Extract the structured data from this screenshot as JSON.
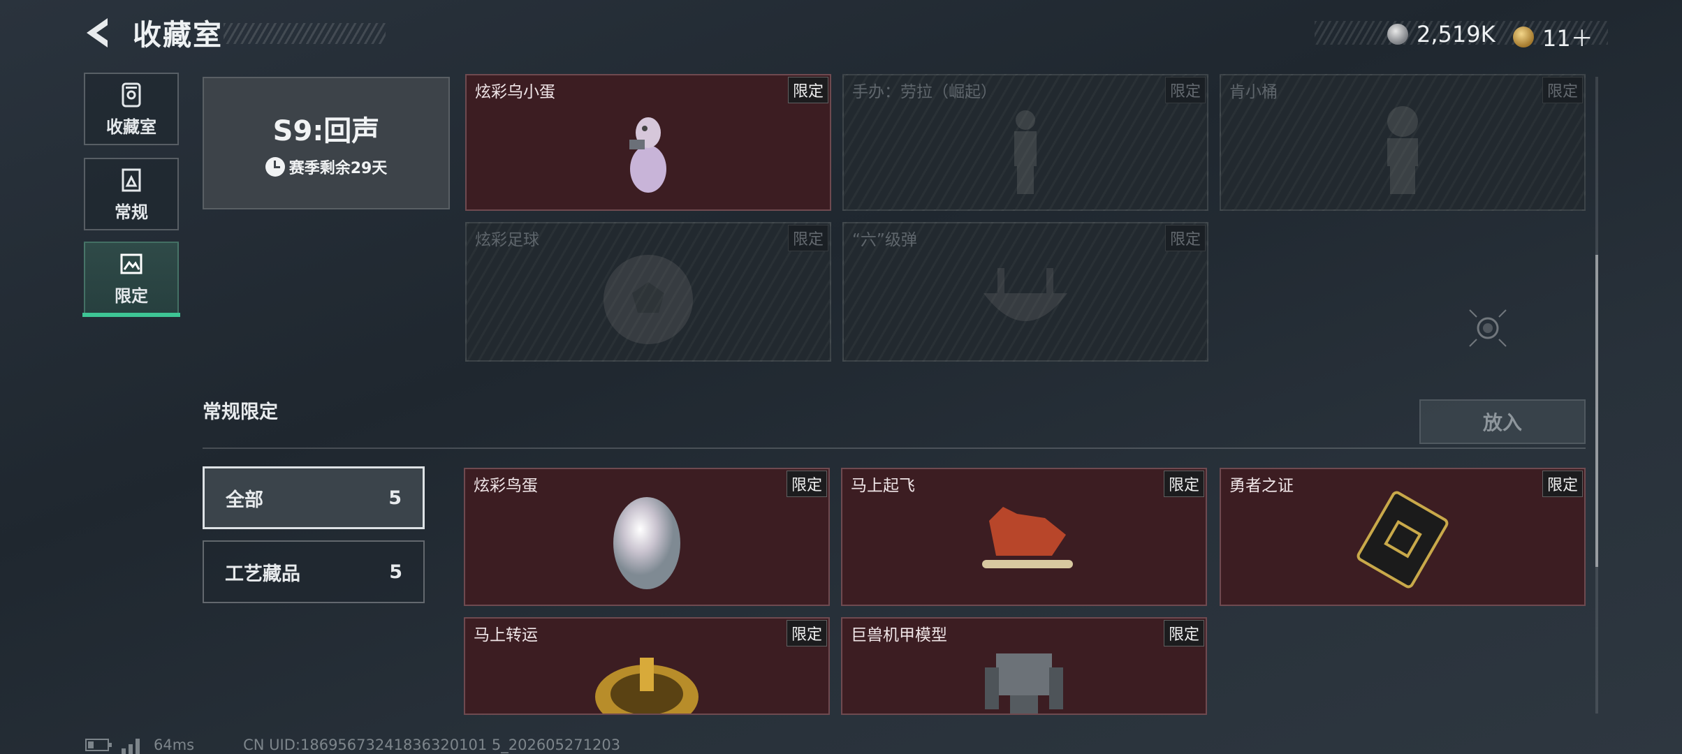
{
  "header": {
    "title": "收藏室",
    "currency1": "2,519K",
    "currency2": "11＋",
    "currency1_icon": "silver-coin-icon",
    "currency2_icon": "gold-triangle-coin-icon"
  },
  "nav": [
    {
      "label": "收藏室",
      "icon": "trophy-icon"
    },
    {
      "label": "常规",
      "icon": "document-icon"
    },
    {
      "label": "限定",
      "icon": "image-icon",
      "active": true
    }
  ],
  "season": {
    "name": "S9:回声",
    "remaining": "赛季剩余29天"
  },
  "season_cards": [
    {
      "name": "炫彩乌小蛋",
      "tag": "限定",
      "owned": true
    },
    {
      "name": "手办：劳拉（崛起）",
      "tag": "限定",
      "owned": false
    },
    {
      "name": "肯小桶",
      "tag": "限定",
      "owned": false
    },
    {
      "name": "炫彩足球",
      "tag": "限定",
      "owned": false
    },
    {
      "name": "“六”级弹",
      "tag": "限定",
      "owned": false
    }
  ],
  "section": {
    "title": "常规限定",
    "put_button": "放入"
  },
  "filters": [
    {
      "label": "全部",
      "count": "5",
      "active": true
    },
    {
      "label": "工艺藏品",
      "count": "5"
    }
  ],
  "regular_cards": [
    {
      "name": "炫彩鸟蛋",
      "tag": "限定"
    },
    {
      "name": "马上起飞",
      "tag": "限定"
    },
    {
      "name": "勇者之证",
      "tag": "限定"
    },
    {
      "name": "马上转运",
      "tag": "限定"
    },
    {
      "name": "巨兽机甲模型",
      "tag": "限定"
    }
  ],
  "footer": {
    "ping": "64ms",
    "uid": "CN UID:18695673241836320101 5_202605271203"
  },
  "colors": {
    "accent": "#3ec595",
    "card_owned": "#3c1d22",
    "card_locked": "#22292f"
  }
}
